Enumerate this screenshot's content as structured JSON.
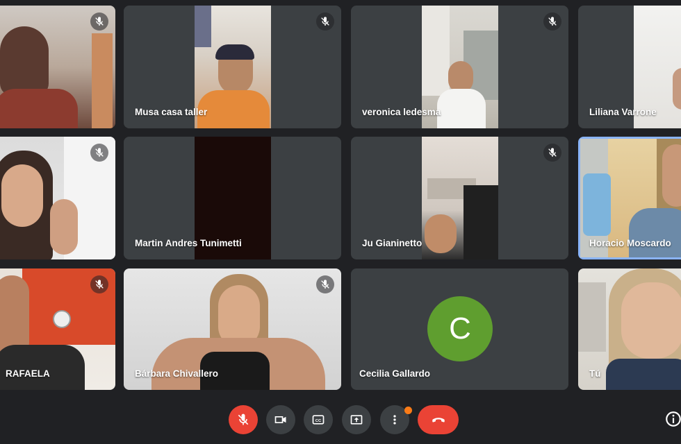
{
  "participants": [
    {
      "name": "",
      "muted": true
    },
    {
      "name": "Musa casa taller",
      "muted": true
    },
    {
      "name": "veronica ledesma",
      "muted": true
    },
    {
      "name": "Liliana Varrone",
      "muted": true
    },
    {
      "name": "",
      "muted": true
    },
    {
      "name": "Martin Andres Tunimetti",
      "muted": false
    },
    {
      "name": "Ju Gianinetto",
      "muted": true
    },
    {
      "name": "Horacio Moscardo",
      "muted": false,
      "active_speaker": true
    },
    {
      "name": "RAFAELA",
      "muted": true
    },
    {
      "name": "Bárbara Chivallero",
      "muted": true
    },
    {
      "name": "Cecilia Gallardo",
      "muted": false,
      "avatar_initial": "C",
      "avatar_color": "#5f9e2f"
    },
    {
      "name": "Tú",
      "muted": false
    }
  ],
  "controls": {
    "mic": {
      "icon": "mic-off-icon",
      "state": "off",
      "color": "#ea4335"
    },
    "camera": {
      "icon": "videocam-icon"
    },
    "captions": {
      "icon": "closed-caption-icon",
      "label": "CC"
    },
    "present": {
      "icon": "present-screen-icon"
    },
    "more": {
      "icon": "more-vert-icon",
      "notification_color": "#fa7b17"
    },
    "hangup": {
      "icon": "call-end-icon",
      "color": "#ea4335"
    },
    "info": {
      "icon": "info-icon"
    }
  },
  "colors": {
    "background": "#202124",
    "tile": "#3c4043",
    "active_border": "#8ab4f8"
  }
}
